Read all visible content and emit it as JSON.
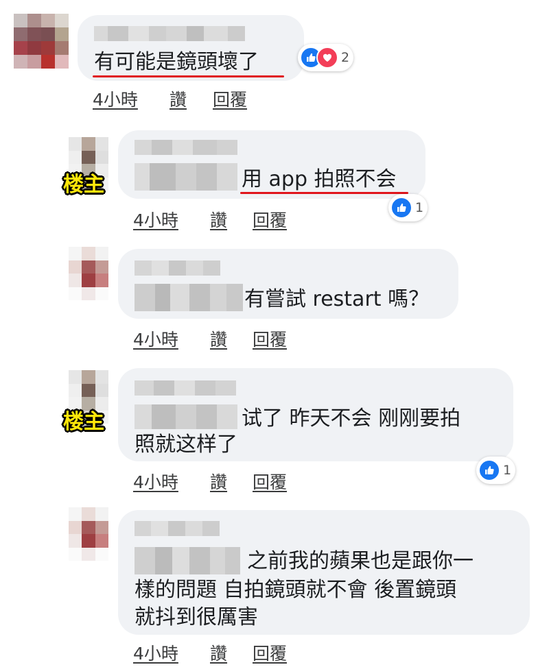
{
  "owner_tag": "楼主",
  "comments": [
    {
      "text": [
        "有可能是鏡頭壞了"
      ],
      "time": "4小時",
      "like": "讚",
      "reply": "回覆",
      "reaction_count": "2"
    },
    {
      "text": [
        "用 app 拍照不会"
      ],
      "time": "4小時",
      "like": "讚",
      "reply": "回覆",
      "reaction_count": "1"
    },
    {
      "text": [
        "有嘗試 restart 嗎？"
      ],
      "time": "4小時",
      "like": "讚",
      "reply": "回覆"
    },
    {
      "text": [
        "试了 昨天不会 刚刚要拍",
        "照就这样了"
      ],
      "time": "4小時",
      "like": "讚",
      "reply": "回覆",
      "reaction_count": "1"
    },
    {
      "text": [
        "之前我的蘋果也是跟你一",
        "樣的問題 自拍鏡頭就不會 後置鏡頭",
        "就抖到很厲害"
      ],
      "time": "4小時",
      "like": "讚",
      "reply": "回覆"
    }
  ],
  "icons": {
    "like": "thumbs-up-icon",
    "love": "heart-icon"
  },
  "colors": {
    "bubble": "#f0f2f5",
    "like": "#1877f2",
    "love": "#f33e58",
    "underline": "#e0151c",
    "owner_tag": "#ffe70a"
  }
}
